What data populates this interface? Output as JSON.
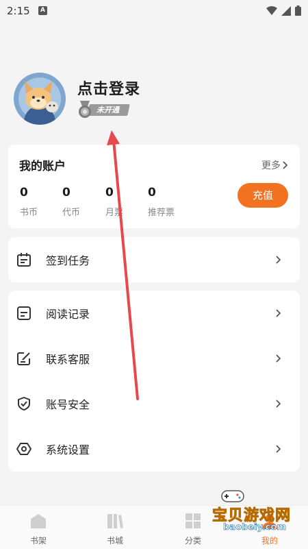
{
  "status_bar": {
    "time": "2:15",
    "notification_letter": "A"
  },
  "profile": {
    "login_text": "点击登录",
    "vip_status": "未开通"
  },
  "account": {
    "title": "我的账户",
    "more": "更多",
    "stats": [
      {
        "value": "0",
        "label": "书币"
      },
      {
        "value": "0",
        "label": "代币"
      },
      {
        "value": "0",
        "label": "月票"
      },
      {
        "value": "0",
        "label": "推荐票"
      }
    ],
    "recharge": "充值"
  },
  "menu_top": [
    {
      "label": "签到任务",
      "icon": "calendar-icon"
    }
  ],
  "menu_main": [
    {
      "label": "阅读记录",
      "icon": "record-icon"
    },
    {
      "label": "联系客服",
      "icon": "edit-icon"
    },
    {
      "label": "账号安全",
      "icon": "shield-icon"
    },
    {
      "label": "系统设置",
      "icon": "settings-icon"
    }
  ],
  "bottom_nav": [
    {
      "label": "书架",
      "icon": "bookshelf-icon"
    },
    {
      "label": "书城",
      "icon": "bookstore-icon"
    },
    {
      "label": "分类",
      "icon": "category-icon"
    },
    {
      "label": "我的",
      "icon": "profile-icon",
      "active": true
    }
  ],
  "watermark": {
    "title": "宝贝游戏网",
    "url": "baobeiy.com"
  },
  "colors": {
    "accent": "#f37222",
    "background": "#f4f4f4",
    "annotation_arrow": "#e8474b"
  }
}
